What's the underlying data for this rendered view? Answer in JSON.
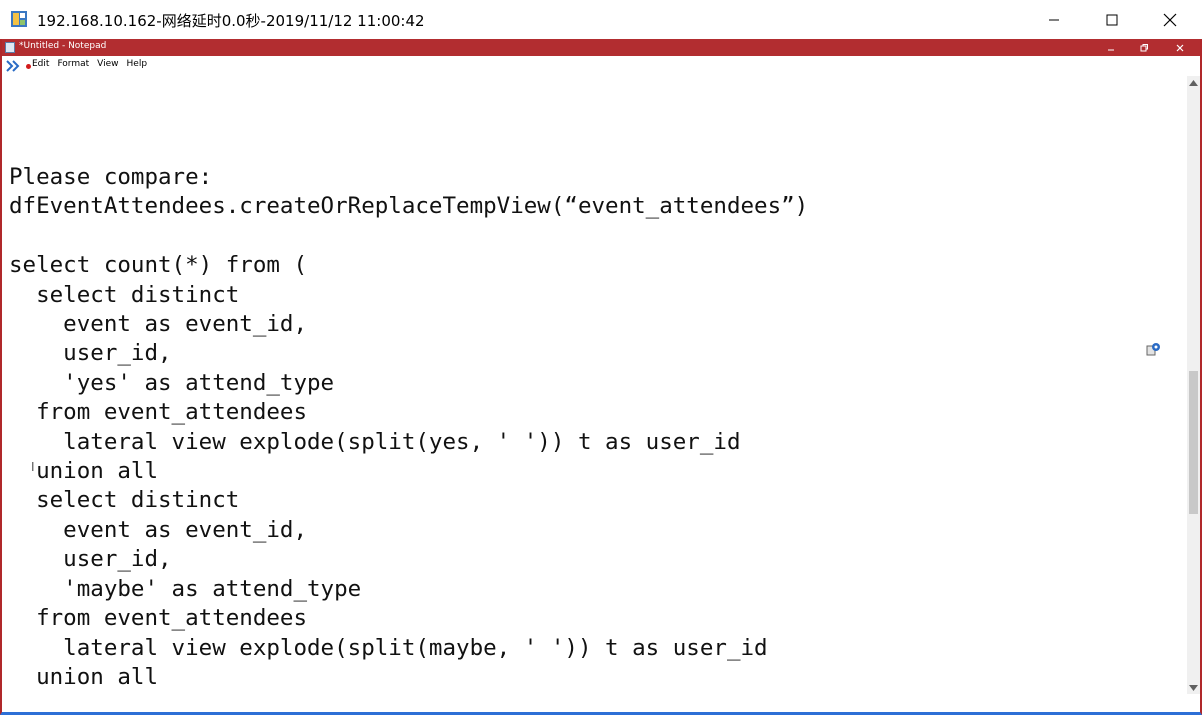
{
  "outer_window": {
    "title": "192.168.10.162-网络延时0.0秒-2019/11/12 11:00:42",
    "icon": "remote-desktop-icon",
    "controls": [
      "minimize-icon",
      "maximize-icon",
      "close-icon"
    ]
  },
  "notepad": {
    "title": "*Untitled - Notepad",
    "menu": [
      "Edit",
      "Format",
      "View",
      "Help"
    ],
    "content": "Please compare:\ndfEventAttendees.createOrReplaceTempView(“event_attendees”)\n\nselect count(*) from (\n  select distinct\n    event as event_id,\n    user_id,\n    'yes' as attend_type\n  from event_attendees\n    lateral view explode(split(yes, ' ')) t as user_id\n  union all\n  select distinct\n    event as event_id,\n    user_id,\n    'maybe' as attend_type\n  from event_attendees\n    lateral view explode(split(maybe, ' ')) t as user_id\n  union all"
  },
  "colors": {
    "inner_title_bar": "#b22d30",
    "bottom_border": "#2d6fd6",
    "menu_dot": "#d21b1b"
  }
}
